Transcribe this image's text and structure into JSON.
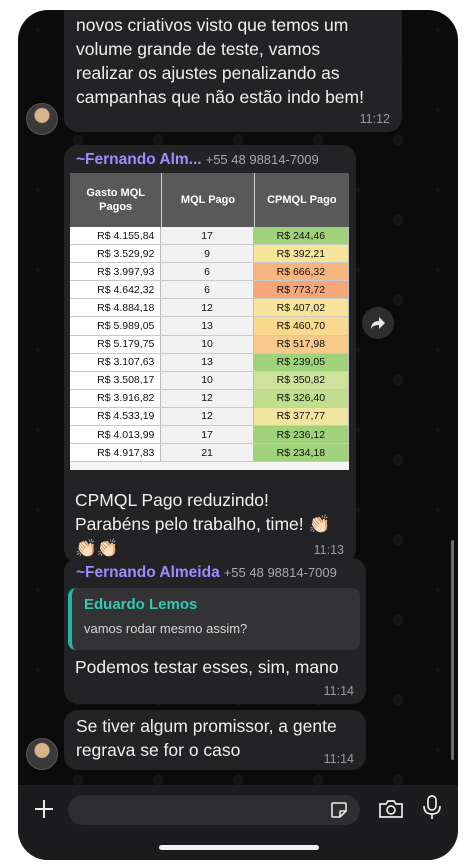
{
  "messages": {
    "first": {
      "lines": [
        "novos criativos visto que temos um",
        "volume grande de teste, vamos",
        "realizar os ajustes penalizando as",
        "campanhas que não estão indo bem!"
      ],
      "time": "11:12"
    },
    "table_msg": {
      "sender": "~Fernando Alm...",
      "phone": "+55 48 98814-7009",
      "caption_lines": [
        "CPMQL Pago reduzindo!",
        "Parabéns pelo trabalho, time! 👏🏻",
        "👏🏻👏🏻"
      ],
      "time": "11:13"
    },
    "reply_msg": {
      "sender": "~Fernando Almeida",
      "phone": "+55 48 98814-7009",
      "quote_name": "Eduardo Lemos",
      "quote_text": "vamos rodar mesmo assim?",
      "text": "Podemos testar esses, sim, mano",
      "time": "11:14"
    },
    "last": {
      "lines": [
        "Se tiver algum promissor, a gente",
        "regrava se for o caso"
      ],
      "time": "11:14"
    }
  },
  "table": {
    "headers": [
      "Gasto MQL Pagos",
      "MQL Pago",
      "CPMQL Pago"
    ],
    "rows": [
      [
        "R$ 4.155,84",
        "17",
        "R$ 244,46"
      ],
      [
        "R$ 3.529,92",
        "9",
        "R$ 392,21"
      ],
      [
        "R$ 3.997,93",
        "6",
        "R$ 666,32"
      ],
      [
        "R$ 4.642,32",
        "6",
        "R$ 773,72"
      ],
      [
        "R$ 4.884,18",
        "12",
        "R$ 407,02"
      ],
      [
        "R$ 5.989,05",
        "13",
        "R$ 460,70"
      ],
      [
        "R$ 5.179,75",
        "10",
        "R$ 517,98"
      ],
      [
        "R$ 3.107,63",
        "13",
        "R$ 239,05"
      ],
      [
        "R$ 3.508,17",
        "10",
        "R$ 350,82"
      ],
      [
        "R$ 3.916,82",
        "12",
        "R$ 326,40"
      ],
      [
        "R$ 4.533,19",
        "12",
        "R$ 377,77"
      ],
      [
        "R$ 4.013,99",
        "17",
        "R$ 236,12"
      ],
      [
        "R$ 4.917,83",
        "21",
        "R$ 234,18"
      ]
    ],
    "cpmql_colors": [
      "#9fd27a",
      "#f7e59a",
      "#f6b57f",
      "#f5a77a",
      "#f8e49b",
      "#f9d98d",
      "#f7c98a",
      "#9fd27a",
      "#cfe19a",
      "#c3dd8f",
      "#f1e59f",
      "#9fd27a",
      "#9fd27a"
    ]
  },
  "icons": {
    "forward": "forward-icon",
    "plus": "plus-icon",
    "sticker": "sticker-icon",
    "camera": "camera-icon",
    "mic": "microphone-icon"
  },
  "colors": {
    "sender": "#9d8cff",
    "quote_bar": "#1fb8a4",
    "bubble": "#232325"
  }
}
